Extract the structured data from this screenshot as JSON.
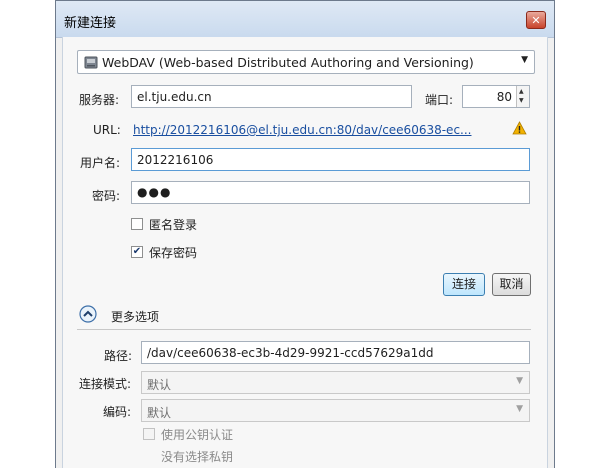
{
  "window": {
    "title": "新建连接",
    "close_glyph": "✕"
  },
  "protocol": {
    "selected": "WebDAV (Web-based Distributed Authoring and Versioning)",
    "icon": "drive-icon"
  },
  "server": {
    "label": "服务器:",
    "value": "el.tju.edu.cn"
  },
  "port": {
    "label": "端口:",
    "value": "80"
  },
  "url": {
    "label": "URL:",
    "value": "http://2012216106@el.tju.edu.cn:80/dav/cee60638-ec...",
    "warning_icon": "warning-icon"
  },
  "username": {
    "label": "用户名:",
    "value": "2012216106"
  },
  "password": {
    "label": "密码:",
    "value": "●●●"
  },
  "anonymous": {
    "label": "匿名登录",
    "checked": false
  },
  "save_password": {
    "label": "保存密码",
    "checked": true
  },
  "buttons": {
    "connect": "连接",
    "cancel": "取消"
  },
  "more_options": {
    "label": "更多选项",
    "expanded": true
  },
  "path": {
    "label": "路径:",
    "value": "/dav/cee60638-ec3b-4d29-9921-ccd57629a1dd"
  },
  "connect_mode": {
    "label": "连接模式:",
    "value": "默认"
  },
  "encoding": {
    "label": "编码:",
    "value": "默认"
  },
  "public_key": {
    "label": "使用公钥认证",
    "checked": false
  },
  "private_key": {
    "label": "没有选择私钥"
  }
}
